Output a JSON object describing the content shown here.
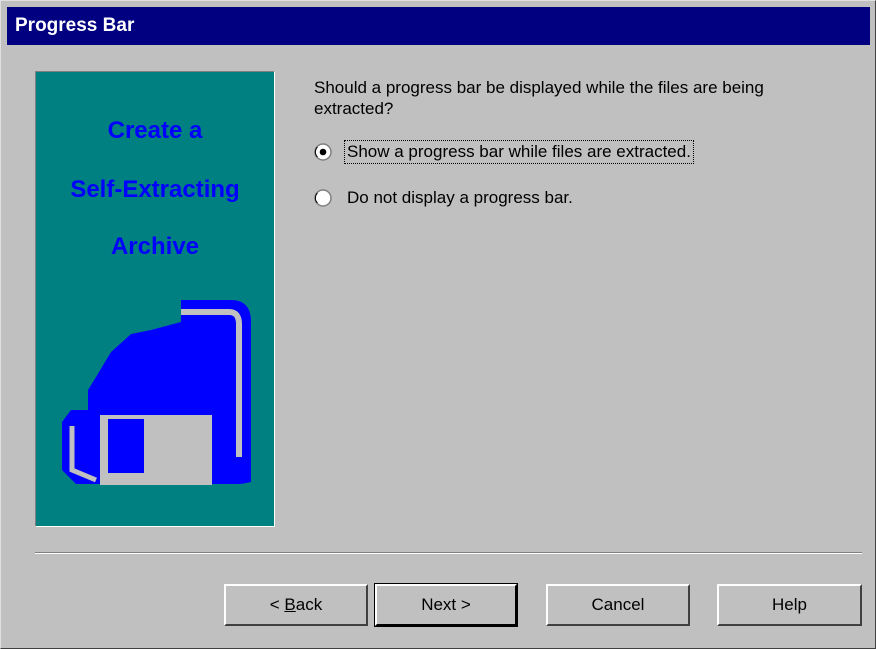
{
  "window": {
    "title": "Progress Bar"
  },
  "side_panel": {
    "line1": "Create a",
    "line2": "Self-Extracting",
    "line3": "Archive",
    "background_color": "#008080",
    "text_color": "#0000ff",
    "icon": "floppy-disk-icon"
  },
  "content": {
    "question": "Should a progress bar be displayed while the files are being extracted?",
    "options": [
      {
        "label": "Show a progress bar while files are extracted.",
        "selected": true
      },
      {
        "label": "Do not display a progress bar.",
        "selected": false
      }
    ]
  },
  "buttons": {
    "back_prefix": "< ",
    "back_mnemonic": "B",
    "back_rest": "ack",
    "next": "Next >",
    "cancel": "Cancel",
    "help": "Help"
  },
  "colors": {
    "titlebar": "#000080",
    "face": "#c0c0c0"
  }
}
